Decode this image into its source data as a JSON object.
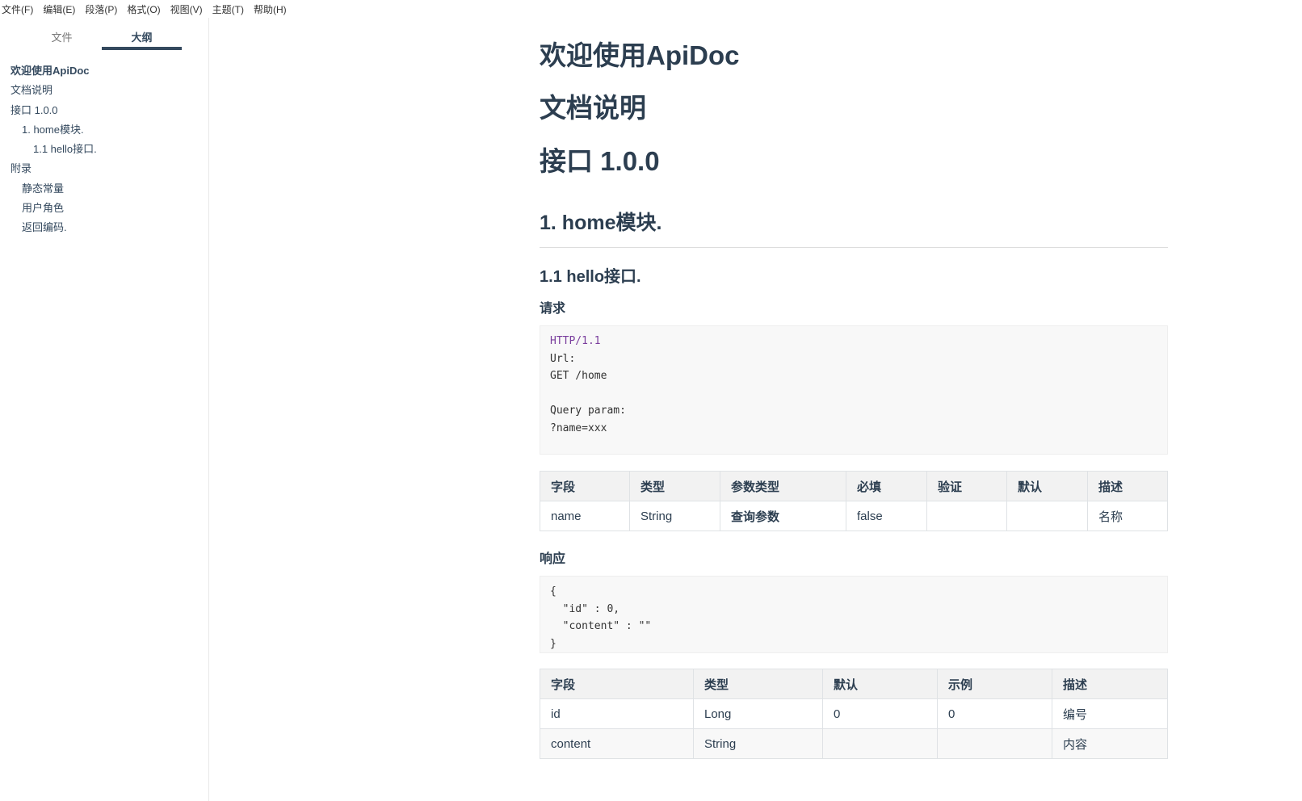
{
  "menu": [
    "文件(F)",
    "编辑(E)",
    "段落(P)",
    "格式(O)",
    "视图(V)",
    "主题(T)",
    "帮助(H)"
  ],
  "sidebar": {
    "tabs": [
      "文件",
      "大纲"
    ],
    "outline": [
      "欢迎使用ApiDoc",
      "文档说明",
      "接口 1.0.0",
      "1. home模块.",
      "1.1 hello接口.",
      "附录",
      "静态常量",
      "用户角色",
      "返回编码."
    ]
  },
  "doc": {
    "h1a": "欢迎使用ApiDoc",
    "h1b": "文档说明",
    "h1c": "接口 1.0.0",
    "h2": "1.  home模块.",
    "h3": "1.1 hello接口.",
    "req_label": "请求",
    "req_code": {
      "l1": "HTTP/1.1",
      "rest": "\nUrl:\nGET /home\n\nQuery param:\n?name=xxx"
    },
    "req_table": {
      "headers": [
        "字段",
        "类型",
        "参数类型",
        "必填",
        "验证",
        "默认",
        "描述"
      ],
      "rows": [
        [
          "name",
          "String",
          "查询参数",
          "false",
          "",
          "",
          "名称"
        ]
      ]
    },
    "resp_label": "响应",
    "resp_code": "{\n  \"id\" : 0,\n  \"content\" : \"\"\n}",
    "resp_table": {
      "headers": [
        "字段",
        "类型",
        "默认",
        "示例",
        "描述"
      ],
      "rows": [
        [
          "id",
          "Long",
          "0",
          "0",
          "编号"
        ],
        [
          "content",
          "String",
          "",
          "",
          "内容"
        ]
      ]
    }
  }
}
